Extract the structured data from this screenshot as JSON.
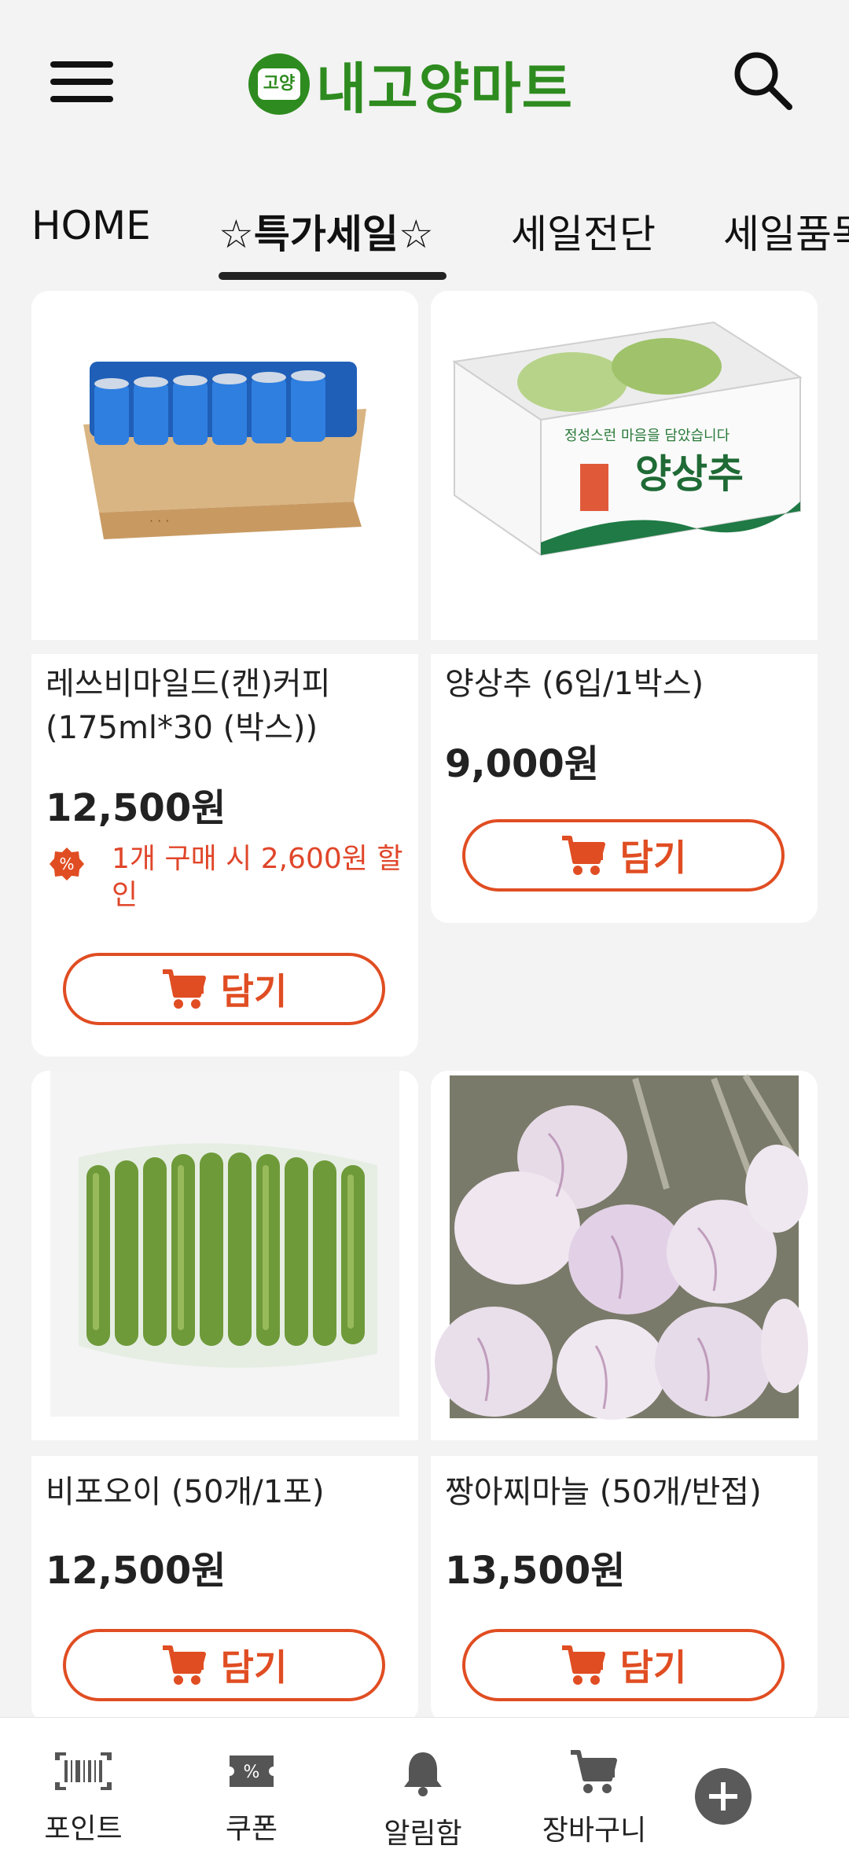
{
  "header": {
    "logo_badge": "고양",
    "logo_text": "내고양마트"
  },
  "tabs": [
    {
      "label": "HOME"
    },
    {
      "label": "☆특가세일☆"
    },
    {
      "label": "세일전단"
    },
    {
      "label": "세일품목"
    }
  ],
  "products": [
    {
      "name": "레쓰비마일드(캔)커피(175ml*30 (박스))",
      "price": "12,500원",
      "discount": "1개 구매 시 2,600원 할인",
      "button": "담기"
    },
    {
      "name": "양상추 (6입/1박스)",
      "price": "9,000원",
      "button": "담기"
    },
    {
      "name": "비포오이 (50개/1포)",
      "price": "12,500원",
      "button": "담기"
    },
    {
      "name": "짱아찌마늘 (50개/반접)",
      "price": "13,500원",
      "button": "담기"
    }
  ],
  "bottom_nav": [
    {
      "label": "포인트",
      "icon": "barcode-icon"
    },
    {
      "label": "쿠폰",
      "icon": "coupon-icon"
    },
    {
      "label": "알림함",
      "icon": "bell-icon"
    },
    {
      "label": "장바구니",
      "icon": "cart-icon"
    }
  ],
  "colors": {
    "brand": "#2e8b1f",
    "accent": "#e04d22"
  }
}
